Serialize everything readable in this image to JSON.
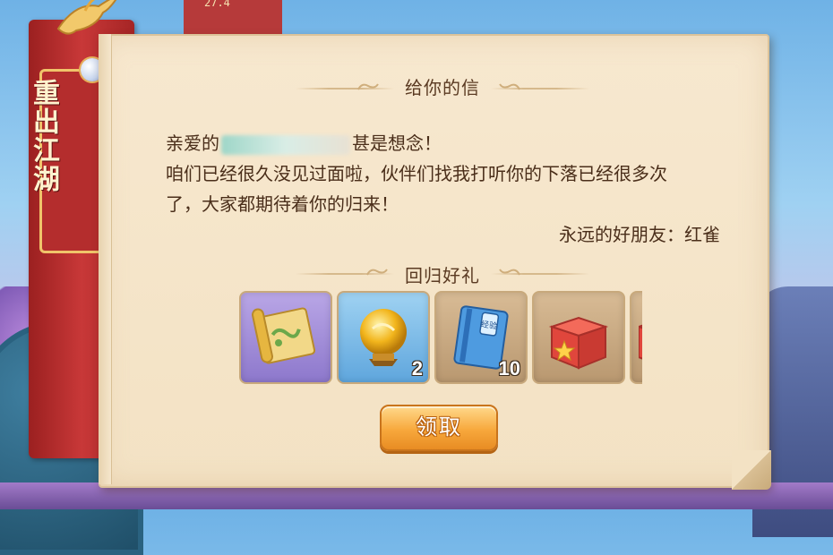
{
  "background": {
    "top_text": "27.4"
  },
  "banner": {
    "title": "重出江湖"
  },
  "letter": {
    "title": "给你的信",
    "greeting_prefix": "亲爱的",
    "greeting_suffix": "甚是想念！",
    "line2": "咱们已经很久没见过面啦，伙伴们找我打听你的下落已经很多次",
    "line3": "了，大家都期待着你的归来！",
    "signature": "永远的好朋友：红雀"
  },
  "rewards": {
    "title": "回归好礼",
    "items": [
      {
        "icon": "treasure-map-icon",
        "count": ""
      },
      {
        "icon": "golden-orb-icon",
        "count": "2"
      },
      {
        "icon": "experience-book-icon",
        "count": "10",
        "book_label": "经验"
      },
      {
        "icon": "gift-box-icon",
        "count": ""
      }
    ]
  },
  "claim_button": {
    "label": "领取"
  },
  "colors": {
    "banner_red": "#c83838",
    "paper": "#f3e2c4",
    "button_orange": "#f7a83c",
    "text_brown": "#4a2e1a"
  }
}
